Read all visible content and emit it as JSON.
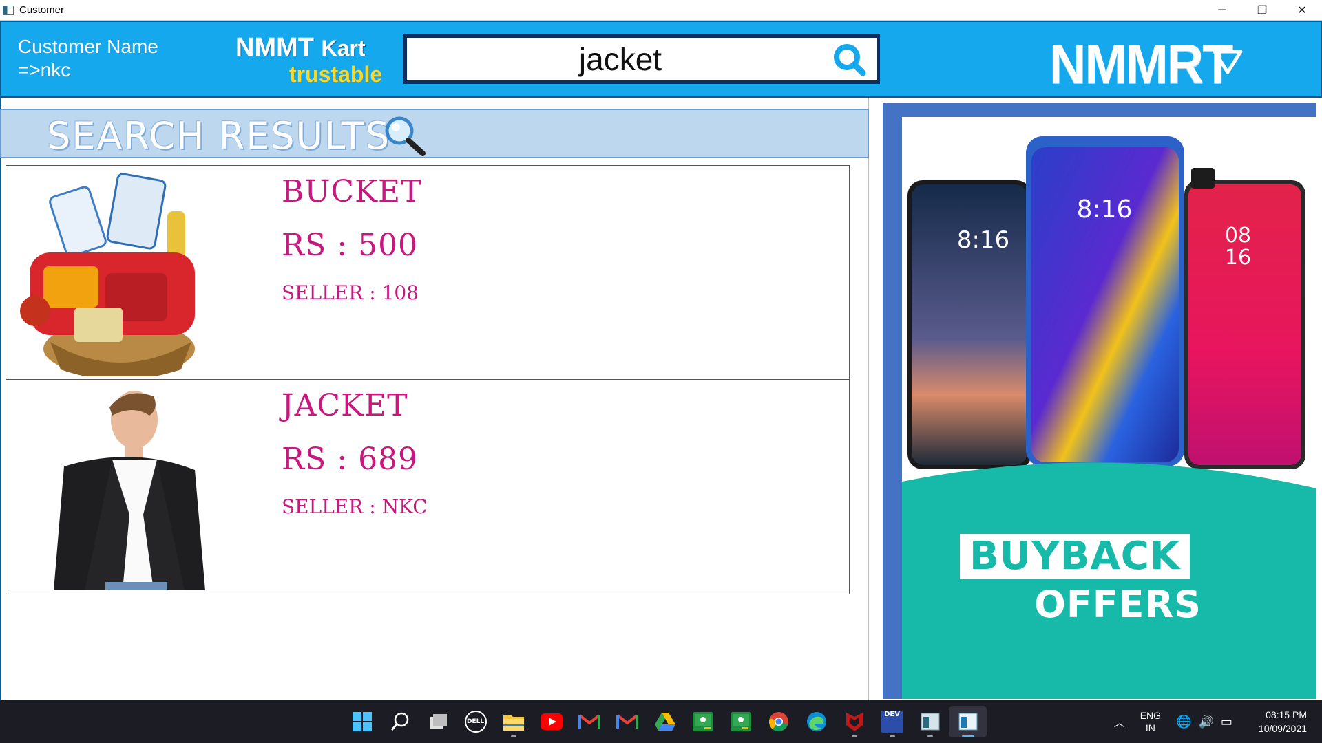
{
  "window": {
    "title": "Customer",
    "minimize": "─",
    "restore": "❐",
    "close": "✕"
  },
  "header": {
    "customer_label": "Customer Name",
    "customer_name": "=>nkc",
    "brand_name": "NMMT",
    "brand_suffix": "Kart",
    "tagline": "trustable",
    "search_value": "jacket",
    "search_icon": "search-icon",
    "logo_text": "NMMRT",
    "menu_icon": "triangle-down-icon"
  },
  "results": {
    "title": "SEARCH RESULTS",
    "products": [
      {
        "name": "BUCKET",
        "price": "RS : 500",
        "seller": "SELLER : 108",
        "image": "grocery-basket"
      },
      {
        "name": "JACKET",
        "price": "RS : 689",
        "seller": "SELLER : NKC",
        "image": "man-in-blazer"
      }
    ]
  },
  "ad": {
    "phone_times": [
      "8:16",
      "8:16",
      "08",
      "16"
    ],
    "line1": "BUYBACK",
    "line2": "OFFERS",
    "colors": {
      "teal": "#17b9a8",
      "frame": "#4472c4"
    }
  },
  "taskbar": {
    "icons": [
      "windows-start-icon",
      "search-icon",
      "task-view-icon",
      "dell-icon",
      "file-explorer-icon",
      "youtube-icon",
      "gmail-icon",
      "gmail-icon",
      "google-drive-icon",
      "google-classroom-icon",
      "google-classroom-icon",
      "chrome-icon",
      "edge-icon",
      "mcafee-icon",
      "dev-cpp-icon",
      "app-window-icon",
      "customer-app-icon"
    ],
    "dell_label": "DELL",
    "dev_label": "DEV",
    "language": "ENG",
    "region": "IN",
    "time": "08:15 PM",
    "date": "10/09/2021"
  },
  "colors": {
    "header": "#16a8ec",
    "banner": "#bdd7ee",
    "product_text": "#c8177e",
    "tagline": "#f8d62b"
  }
}
